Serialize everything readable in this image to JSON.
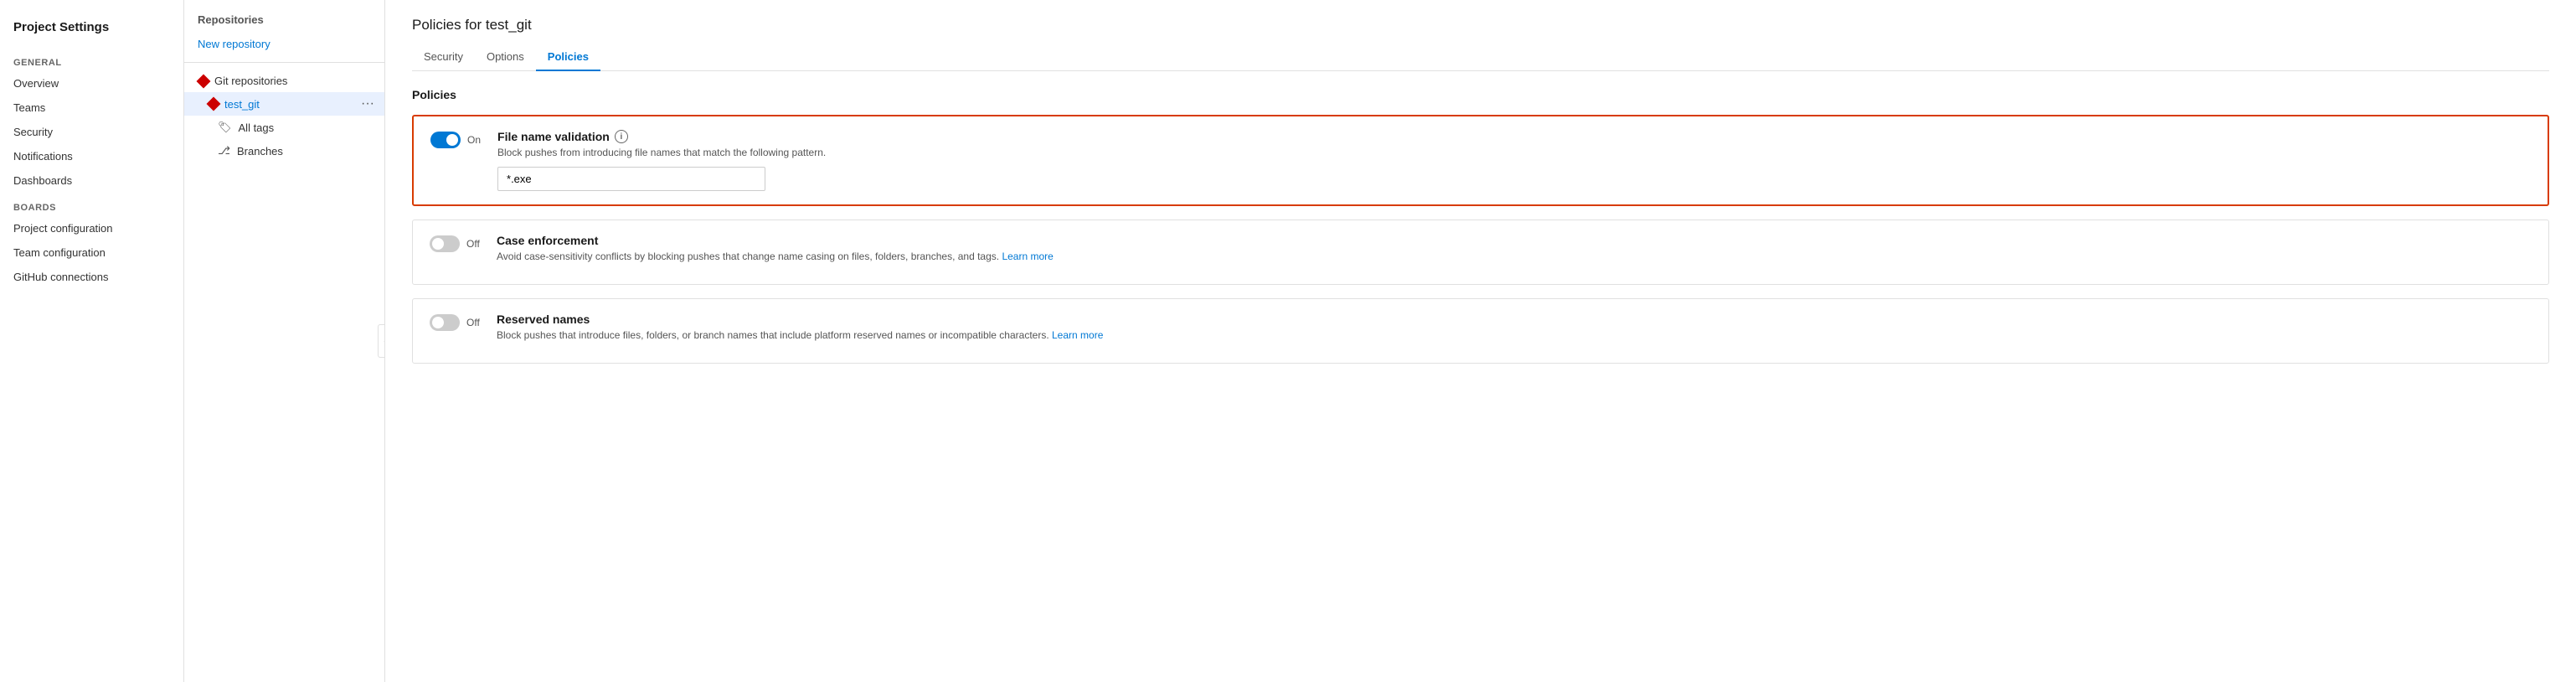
{
  "sidebar": {
    "title": "Project Settings",
    "sections": [
      {
        "label": "General",
        "items": [
          {
            "id": "overview",
            "label": "Overview"
          },
          {
            "id": "teams",
            "label": "Teams"
          },
          {
            "id": "security",
            "label": "Security"
          },
          {
            "id": "notifications",
            "label": "Notifications"
          },
          {
            "id": "dashboards",
            "label": "Dashboards"
          }
        ]
      },
      {
        "label": "Boards",
        "items": [
          {
            "id": "project-configuration",
            "label": "Project configuration"
          },
          {
            "id": "team-configuration",
            "label": "Team configuration"
          },
          {
            "id": "github-connections",
            "label": "GitHub connections"
          }
        ]
      }
    ]
  },
  "mid_panel": {
    "header": "Repositories",
    "new_repo": "New repository",
    "git_section": "Git repositories",
    "repos": [
      {
        "id": "test_git",
        "name": "test_git"
      }
    ],
    "sub_items": [
      {
        "id": "all-tags",
        "label": "All tags",
        "icon": "🏷"
      },
      {
        "id": "branches",
        "label": "Branches",
        "icon": "⎇"
      }
    ]
  },
  "main": {
    "page_title": "Policies for test_git",
    "tabs": [
      {
        "id": "security",
        "label": "Security",
        "active": false
      },
      {
        "id": "options",
        "label": "Options",
        "active": false
      },
      {
        "id": "policies",
        "label": "Policies",
        "active": true
      }
    ],
    "section_title": "Policies",
    "policies": [
      {
        "id": "file-name-validation",
        "name": "File name validation",
        "desc": "Block pushes from introducing file names that match the following pattern.",
        "enabled": true,
        "toggle_label": "On",
        "input_value": "*.exe",
        "highlighted": true,
        "has_info": true,
        "learn_more": null
      },
      {
        "id": "case-enforcement",
        "name": "Case enforcement",
        "desc": "Avoid case-sensitivity conflicts by blocking pushes that change name casing on files, folders, branches, and tags.",
        "enabled": false,
        "toggle_label": "Off",
        "input_value": null,
        "highlighted": false,
        "has_info": false,
        "learn_more": "Learn more"
      },
      {
        "id": "reserved-names",
        "name": "Reserved names",
        "desc": "Block pushes that introduce files, folders, or branch names that include platform reserved names or incompatible characters.",
        "enabled": false,
        "toggle_label": "Off",
        "input_value": null,
        "highlighted": false,
        "has_info": false,
        "learn_more": "Learn more"
      }
    ]
  }
}
